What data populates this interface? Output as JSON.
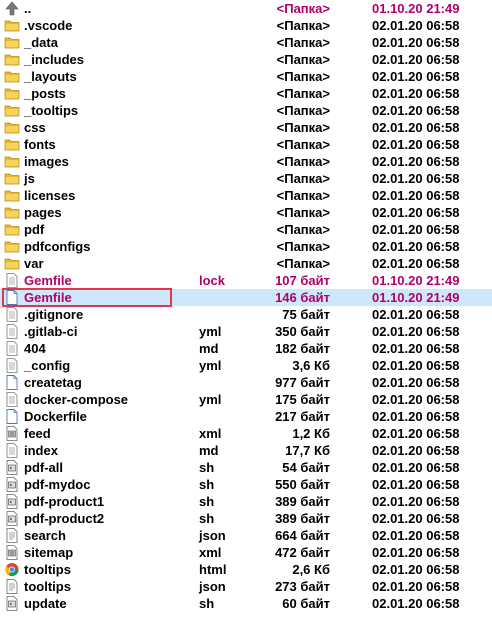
{
  "rows": [
    {
      "name": "..",
      "ext": "",
      "size": "<Папка>",
      "date": "01.10.20 21:49",
      "icon": "up-arrow-icon",
      "kind": "up"
    },
    {
      "name": ".vscode",
      "ext": "",
      "size": "<Папка>",
      "date": "02.01.20 06:58",
      "icon": "folder-icon",
      "kind": "folder"
    },
    {
      "name": "_data",
      "ext": "",
      "size": "<Папка>",
      "date": "02.01.20 06:58",
      "icon": "folder-icon",
      "kind": "folder"
    },
    {
      "name": "_includes",
      "ext": "",
      "size": "<Папка>",
      "date": "02.01.20 06:58",
      "icon": "folder-icon",
      "kind": "folder"
    },
    {
      "name": "_layouts",
      "ext": "",
      "size": "<Папка>",
      "date": "02.01.20 06:58",
      "icon": "folder-icon",
      "kind": "folder"
    },
    {
      "name": "_posts",
      "ext": "",
      "size": "<Папка>",
      "date": "02.01.20 06:58",
      "icon": "folder-icon",
      "kind": "folder"
    },
    {
      "name": "_tooltips",
      "ext": "",
      "size": "<Папка>",
      "date": "02.01.20 06:58",
      "icon": "folder-icon",
      "kind": "folder"
    },
    {
      "name": "css",
      "ext": "",
      "size": "<Папка>",
      "date": "02.01.20 06:58",
      "icon": "folder-icon",
      "kind": "folder"
    },
    {
      "name": "fonts",
      "ext": "",
      "size": "<Папка>",
      "date": "02.01.20 06:58",
      "icon": "folder-icon",
      "kind": "folder"
    },
    {
      "name": "images",
      "ext": "",
      "size": "<Папка>",
      "date": "02.01.20 06:58",
      "icon": "folder-icon",
      "kind": "folder"
    },
    {
      "name": "js",
      "ext": "",
      "size": "<Папка>",
      "date": "02.01.20 06:58",
      "icon": "folder-icon",
      "kind": "folder"
    },
    {
      "name": "licenses",
      "ext": "",
      "size": "<Папка>",
      "date": "02.01.20 06:58",
      "icon": "folder-icon",
      "kind": "folder"
    },
    {
      "name": "pages",
      "ext": "",
      "size": "<Папка>",
      "date": "02.01.20 06:58",
      "icon": "folder-icon",
      "kind": "folder"
    },
    {
      "name": "pdf",
      "ext": "",
      "size": "<Папка>",
      "date": "02.01.20 06:58",
      "icon": "folder-icon",
      "kind": "folder"
    },
    {
      "name": "pdfconfigs",
      "ext": "",
      "size": "<Папка>",
      "date": "02.01.20 06:58",
      "icon": "folder-icon",
      "kind": "folder"
    },
    {
      "name": "var",
      "ext": "",
      "size": "<Папка>",
      "date": "02.01.20 06:58",
      "icon": "folder-icon",
      "kind": "folder"
    },
    {
      "name": "Gemfile",
      "ext": "lock",
      "size": "107 байт",
      "date": "01.10.20 21:49",
      "icon": "text-file-icon",
      "kind": "hl"
    },
    {
      "name": "Gemfile",
      "ext": "",
      "size": "146 байт",
      "date": "01.10.20 21:49",
      "icon": "document-icon",
      "kind": "hl-selected"
    },
    {
      "name": ".gitignore",
      "ext": "",
      "size": "75 байт",
      "date": "02.01.20 06:58",
      "icon": "text-file-icon",
      "kind": "file"
    },
    {
      "name": ".gitlab-ci",
      "ext": "yml",
      "size": "350 байт",
      "date": "02.01.20 06:58",
      "icon": "text-file-icon",
      "kind": "file"
    },
    {
      "name": "404",
      "ext": "md",
      "size": "182 байт",
      "date": "02.01.20 06:58",
      "icon": "text-file-icon",
      "kind": "file"
    },
    {
      "name": "_config",
      "ext": "yml",
      "size": "3,6 Кб",
      "date": "02.01.20 06:58",
      "icon": "text-file-icon",
      "kind": "file"
    },
    {
      "name": "createtag",
      "ext": "",
      "size": "977 байт",
      "date": "02.01.20 06:58",
      "icon": "document-icon",
      "kind": "file"
    },
    {
      "name": "docker-compose",
      "ext": "yml",
      "size": "175 байт",
      "date": "02.01.20 06:58",
      "icon": "text-file-icon",
      "kind": "file"
    },
    {
      "name": "Dockerfile",
      "ext": "",
      "size": "217 байт",
      "date": "02.01.20 06:58",
      "icon": "document-icon",
      "kind": "file"
    },
    {
      "name": "feed",
      "ext": "xml",
      "size": "1,2 Кб",
      "date": "02.01.20 06:58",
      "icon": "xml-file-icon",
      "kind": "file"
    },
    {
      "name": "index",
      "ext": "md",
      "size": "17,7 Кб",
      "date": "02.01.20 06:58",
      "icon": "text-file-icon",
      "kind": "file"
    },
    {
      "name": "pdf-all",
      "ext": "sh",
      "size": "54 байт",
      "date": "02.01.20 06:58",
      "icon": "script-file-icon",
      "kind": "file"
    },
    {
      "name": "pdf-mydoc",
      "ext": "sh",
      "size": "550 байт",
      "date": "02.01.20 06:58",
      "icon": "script-file-icon",
      "kind": "file"
    },
    {
      "name": "pdf-product1",
      "ext": "sh",
      "size": "389 байт",
      "date": "02.01.20 06:58",
      "icon": "script-file-icon",
      "kind": "file"
    },
    {
      "name": "pdf-product2",
      "ext": "sh",
      "size": "389 байт",
      "date": "02.01.20 06:58",
      "icon": "script-file-icon",
      "kind": "file"
    },
    {
      "name": "search",
      "ext": "json",
      "size": "664 байт",
      "date": "02.01.20 06:58",
      "icon": "json-file-icon",
      "kind": "file"
    },
    {
      "name": "sitemap",
      "ext": "xml",
      "size": "472 байт",
      "date": "02.01.20 06:58",
      "icon": "xml-file-icon",
      "kind": "file"
    },
    {
      "name": "tooltips",
      "ext": "html",
      "size": "2,6 Кб",
      "date": "02.01.20 06:58",
      "icon": "chrome-html-icon",
      "kind": "file"
    },
    {
      "name": "tooltips",
      "ext": "json",
      "size": "273 байт",
      "date": "02.01.20 06:58",
      "icon": "json-file-icon",
      "kind": "file"
    },
    {
      "name": "update",
      "ext": "sh",
      "size": "60 байт",
      "date": "02.01.20 06:58",
      "icon": "script-file-icon",
      "kind": "file"
    }
  ],
  "colors": {
    "highlight_text": "#b0006a",
    "selection_bg": "#cde8fb",
    "selection_border": "#e0384a",
    "folder": "#e8b92a"
  }
}
